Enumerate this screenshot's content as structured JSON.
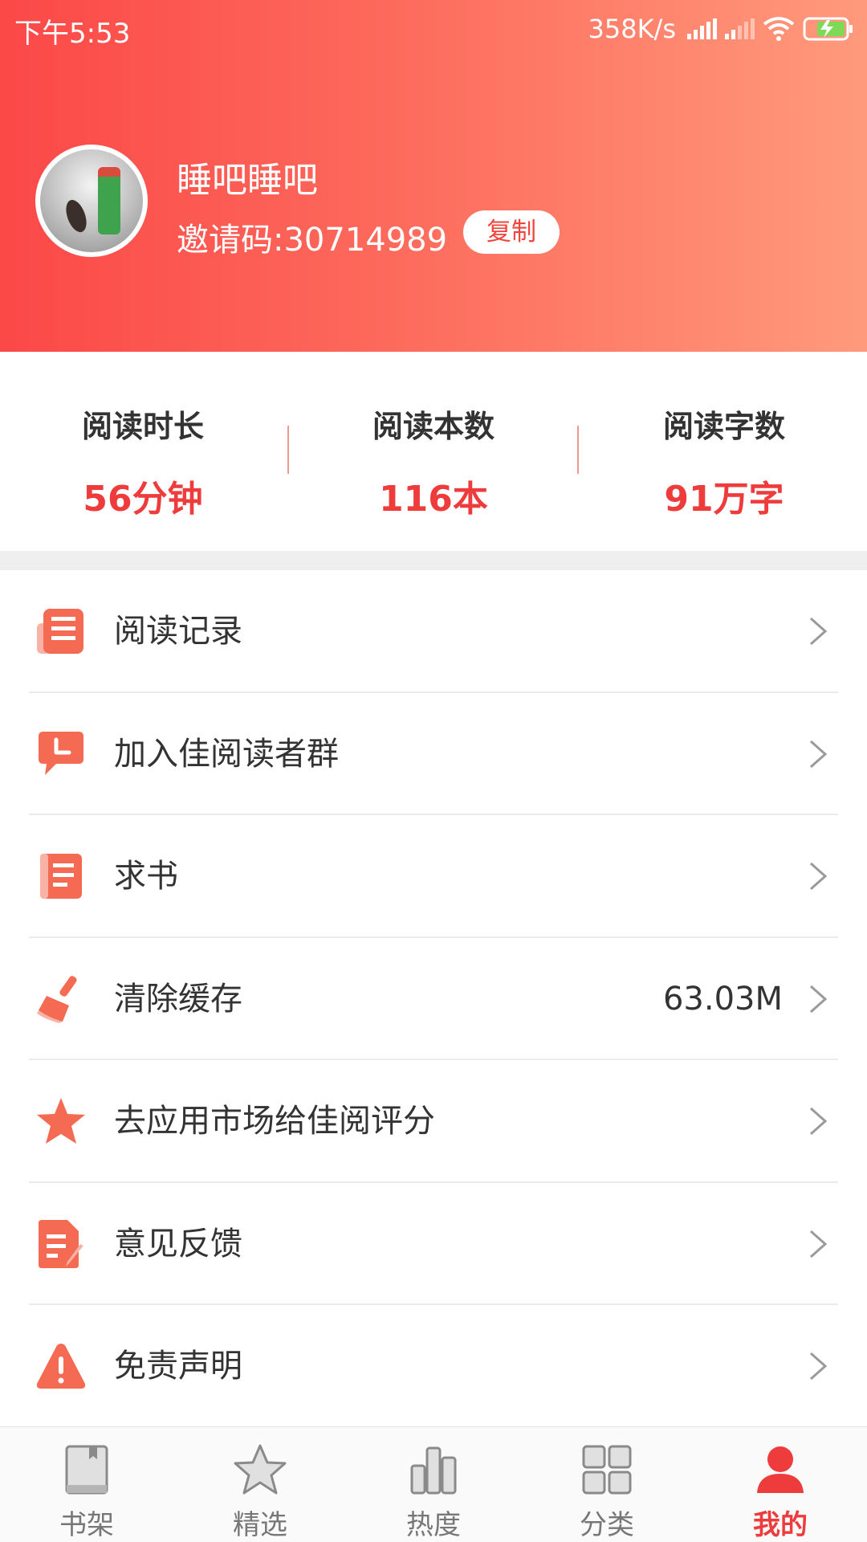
{
  "status_bar": {
    "time": "下午5:53",
    "network_speed": "358K/s",
    "icons": [
      "signal-icon",
      "signal-icon",
      "wifi-icon",
      "battery-charging-icon"
    ]
  },
  "profile": {
    "name": "睡吧睡吧",
    "invite_code_text": "邀请码:30714989",
    "copy_label": "复制"
  },
  "stats": [
    {
      "label": "阅读时长",
      "value": "56分钟"
    },
    {
      "label": "阅读本数",
      "value": "116本"
    },
    {
      "label": "阅读字数",
      "value": "91万字"
    }
  ],
  "menu": {
    "items": [
      {
        "label": "阅读记录",
        "icon": "reading-record-icon"
      },
      {
        "label": "加入佳阅读者群",
        "icon": "chat-clock-icon"
      },
      {
        "label": "求书",
        "icon": "book-request-icon"
      },
      {
        "label": "清除缓存",
        "icon": "broom-icon",
        "value": "63.03M"
      },
      {
        "label": "去应用市场给佳阅评分",
        "icon": "star-icon"
      },
      {
        "label": "意见反馈",
        "icon": "feedback-icon"
      },
      {
        "label": "免责声明",
        "icon": "warning-icon"
      }
    ]
  },
  "tabbar": {
    "tabs": [
      {
        "label": "书架",
        "icon": "bookshelf-icon"
      },
      {
        "label": "精选",
        "icon": "star-outline-icon"
      },
      {
        "label": "热度",
        "icon": "bar-chart-icon"
      },
      {
        "label": "分类",
        "icon": "grid-icon"
      },
      {
        "label": "我的",
        "icon": "person-icon",
        "active": true
      }
    ]
  },
  "colors": {
    "accent": "#ee3b3b",
    "header_start": "#fb4848",
    "header_end": "#ff9a7c",
    "icon": "#f46a52"
  }
}
